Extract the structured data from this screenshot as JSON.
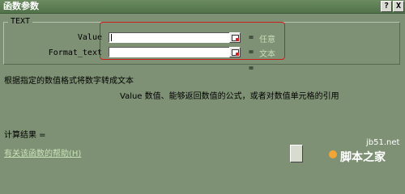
{
  "window": {
    "title": "函数参数",
    "help_glyph": "?",
    "close_glyph": "X"
  },
  "group": {
    "label": "TEXT"
  },
  "params": [
    {
      "label": "Value",
      "value": "",
      "eq": "=",
      "hint": "任意"
    },
    {
      "label": "Format_text",
      "value": "",
      "eq": "=",
      "hint": "文本"
    }
  ],
  "result_eq": "=",
  "description": {
    "main": "根据指定的数值格式将数字转成文本",
    "param": "Value  数值、能够返回数值的公式，或者对数值单元格的引用"
  },
  "calc_result": "计算结果 =",
  "help_link": "有关该函数的帮助(H)",
  "watermark": {
    "line1": "jb51.net",
    "line2": "脚本之家"
  },
  "colors": {
    "background": "#7e9175",
    "highlight": "#c81e1e",
    "hint": "#c5dcb8"
  }
}
